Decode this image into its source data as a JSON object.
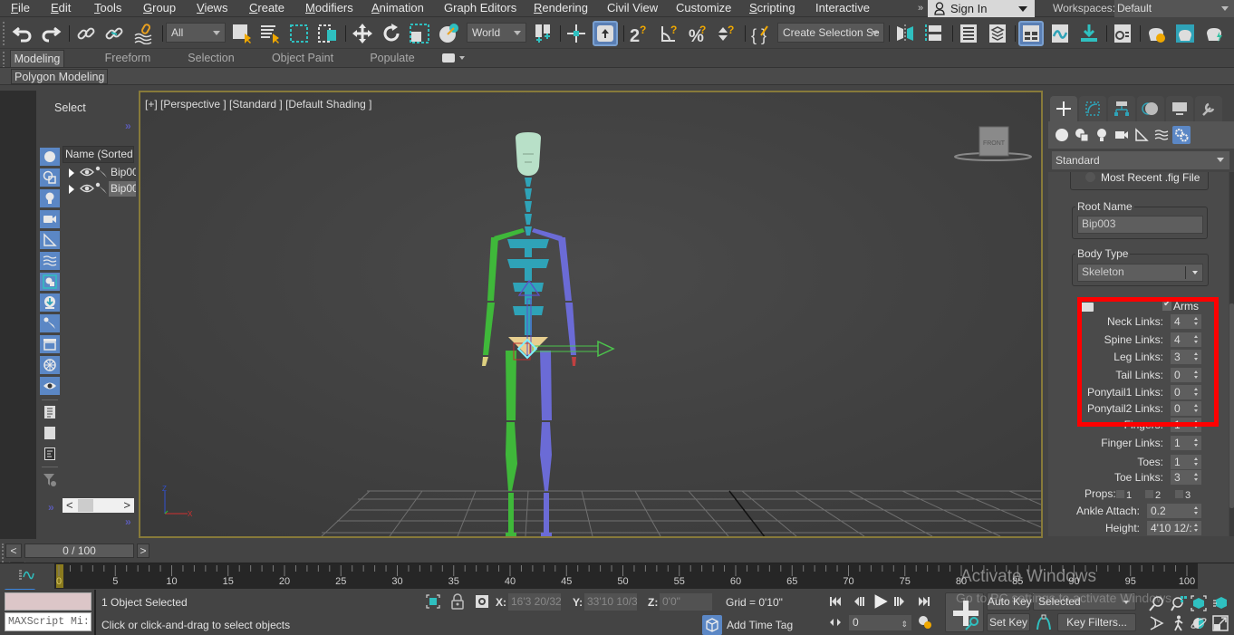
{
  "menubar": {
    "items": [
      {
        "label": "File",
        "u": "F",
        "rest": "ile"
      },
      {
        "label": "Edit",
        "u": "E",
        "rest": "dit"
      },
      {
        "label": "Tools",
        "u": "T",
        "rest": "ools"
      },
      {
        "label": "Group",
        "u": "G",
        "rest": "roup"
      },
      {
        "label": "Views",
        "u": "V",
        "rest": "iews"
      },
      {
        "label": "Create",
        "u": "C",
        "rest": "reate"
      },
      {
        "label": "Modifiers",
        "u": "M",
        "rest": "odifiers"
      },
      {
        "label": "Animation",
        "u": "A",
        "rest": "nimation"
      },
      {
        "label": "Graph Editors",
        "u": "",
        "rest": "Graph Editors"
      },
      {
        "label": "Rendering",
        "u": "R",
        "rest": "endering"
      },
      {
        "label": "Civil View",
        "u": "",
        "rest": "Civil View"
      },
      {
        "label": "Customize",
        "u": "",
        "rest": "Customize"
      },
      {
        "label": "Scripting",
        "u": "S",
        "rest": "cripting"
      },
      {
        "label": "Interactive",
        "u": "",
        "rest": "Interactive"
      }
    ],
    "more": "»",
    "sign_in": "Sign In",
    "workspaces_label": "Workspaces:",
    "workspace_value": "Default"
  },
  "toolbar": {
    "selection_filter": "All",
    "ref_coord": "World",
    "named_selection": "Create Selection Se",
    "icons": [
      "undo-icon",
      "redo-icon",
      "link-icon",
      "unlink-icon",
      "bind-space-warp-icon",
      "select-object-icon",
      "select-by-name-icon",
      "rect-selection-region-icon",
      "window-crossing-icon",
      "move-icon",
      "rotate-icon",
      "scale-icon",
      "placement-icon",
      "pivot-center-icon",
      "select-manipulate-icon",
      "keyboard-shortcut-override-icon",
      "snaps-toggle-icon",
      "angle-snap-icon",
      "percent-snap-icon",
      "spinner-snap-icon",
      "edit-named-selection-icon",
      "mirror-icon",
      "align-icon",
      "scene-explorer-icon",
      "layer-explorer-icon",
      "toggle-ribbon-icon",
      "curve-editor-icon",
      "schematic-view-icon",
      "material-editor-icon",
      "render-setup-icon",
      "rendered-frame-window-icon",
      "render-production-icon"
    ]
  },
  "ribbon": {
    "tabs": [
      "Modeling",
      "Freeform",
      "Selection",
      "Object Paint",
      "Populate"
    ],
    "active_tab": "Modeling",
    "sub_panel": "Polygon Modeling"
  },
  "scene_explorer": {
    "title": "Select",
    "column_header": "Name (Sorted A",
    "rows": [
      {
        "name": "Bip00",
        "selected": false
      },
      {
        "name": "Bip00",
        "selected": true
      }
    ],
    "filter_icons": [
      "geometry-filter-icon",
      "shapes-filter-icon",
      "lights-filter-icon",
      "cameras-filter-icon",
      "helpers-filter-icon",
      "spacewarps-filter-icon",
      "groups-filter-icon",
      "xrefs-filter-icon",
      "bones-filter-icon",
      "containers-filter-icon",
      "frozen-filter-icon",
      "hidden-filter-icon",
      "display-all-icon",
      "display-none-icon",
      "invert-display-icon",
      "filter-settings-icon"
    ]
  },
  "viewport": {
    "label": "[+] [Perspective ] [Standard ] [Default Shading ]",
    "viewcube_face": "FRONT",
    "axis_z": "Z",
    "axis_x": "X"
  },
  "command_panel": {
    "tabs": [
      "create-tab",
      "modify-tab",
      "hierarchy-tab",
      "motion-tab",
      "display-tab",
      "utilities-tab"
    ],
    "active_tab": "create-tab",
    "categories": [
      "geometry",
      "shapes",
      "lights",
      "cameras",
      "helpers",
      "space-warps",
      "systems"
    ],
    "active_category": "systems",
    "category_dropdown": "Standard",
    "most_recent_fig": "Most Recent .fig File",
    "root_name_title": "Root Name",
    "root_name_value": "Bip003",
    "body_type_title": "Body Type",
    "body_type_value": "Skeleton",
    "arms_label": "Arms",
    "arms_checked": true,
    "spinners": [
      {
        "label": "Neck Links:",
        "value": "4"
      },
      {
        "label": "Spine Links:",
        "value": "4"
      },
      {
        "label": "Leg Links:",
        "value": "3"
      },
      {
        "label": "Tail Links:",
        "value": "0"
      },
      {
        "label": "Ponytail1 Links:",
        "value": "0"
      },
      {
        "label": "Ponytail2 Links:",
        "value": "0"
      },
      {
        "label": "Fingers:",
        "value": "1"
      },
      {
        "label": "Finger Links:",
        "value": "1"
      },
      {
        "label": "Toes:",
        "value": "1"
      },
      {
        "label": "Toe Links:",
        "value": "3"
      }
    ],
    "props_label": "Props:",
    "props": [
      "1",
      "2",
      "3"
    ],
    "ankle_attach_label": "Ankle Attach:",
    "ankle_attach_value": "0.2",
    "height_label": "Height:",
    "height_value": "4'10 12/:"
  },
  "timeline": {
    "slider_text": "0 / 100",
    "prev": "<",
    "next": ">",
    "current_frame": 0,
    "start": 0,
    "end": 100,
    "tick_labels": [
      "0",
      "5",
      "10",
      "15",
      "20",
      "25",
      "30",
      "35",
      "40",
      "45",
      "50",
      "55",
      "60",
      "65",
      "70",
      "75",
      "80",
      "85",
      "90",
      "95",
      "100"
    ]
  },
  "status": {
    "maxscript": "MAXScript Mi:",
    "selection": "1 Object Selected",
    "prompt": "Click or click-and-drag to select objects",
    "x_label": "X:",
    "x_value": "16'3 20/32'",
    "y_label": "Y:",
    "y_value": "33'10 10/3:",
    "z_label": "Z:",
    "z_value": "0'0\"",
    "grid": "Grid = 0'10\"",
    "add_time_tag": "Add Time Tag",
    "frame_value": "0",
    "auto_key": "Auto Key",
    "selected_dd": "Selected",
    "set_key": "Set Key",
    "key_filters": "Key Filters..."
  },
  "watermark": {
    "line1": "Activate Windows",
    "line2": "Go to PC settings to activate Windows."
  },
  "colors": {
    "viewport_border": "#877a3a",
    "highlight_box": "#ff0000",
    "active_blue": "#5b87c5",
    "biped_left": "#3fb83a",
    "biped_right": "#6b6bd6",
    "biped_spine": "#2fa3b8",
    "head": "#b8e0c8"
  }
}
